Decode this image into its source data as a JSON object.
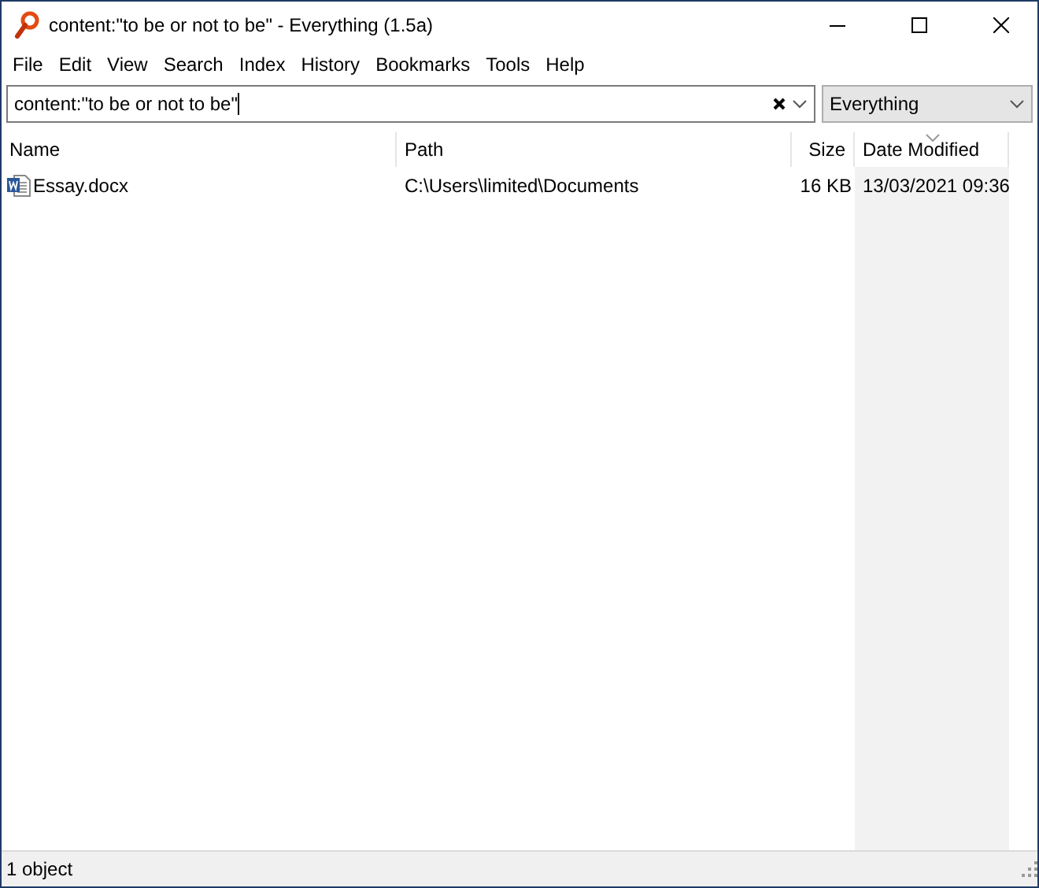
{
  "window": {
    "title": "content:\"to be or not to be\" - Everything (1.5a)"
  },
  "menu": [
    "File",
    "Edit",
    "View",
    "Search",
    "Index",
    "History",
    "Bookmarks",
    "Tools",
    "Help"
  ],
  "search": {
    "value": "content:\"to be or not to be\""
  },
  "filter": {
    "value": "Everything"
  },
  "table": {
    "columns": [
      {
        "label": "Name",
        "sorted": false
      },
      {
        "label": "Path",
        "sorted": false
      },
      {
        "label": "Size",
        "sorted": false
      },
      {
        "label": "Date Modified",
        "sorted": true
      }
    ],
    "rows": [
      {
        "name": "Essay.docx",
        "path": "C:\\Users\\limited\\Documents",
        "size": "16 KB",
        "date": "13/03/2021 09:36"
      }
    ]
  },
  "status_bar": "1 object"
}
